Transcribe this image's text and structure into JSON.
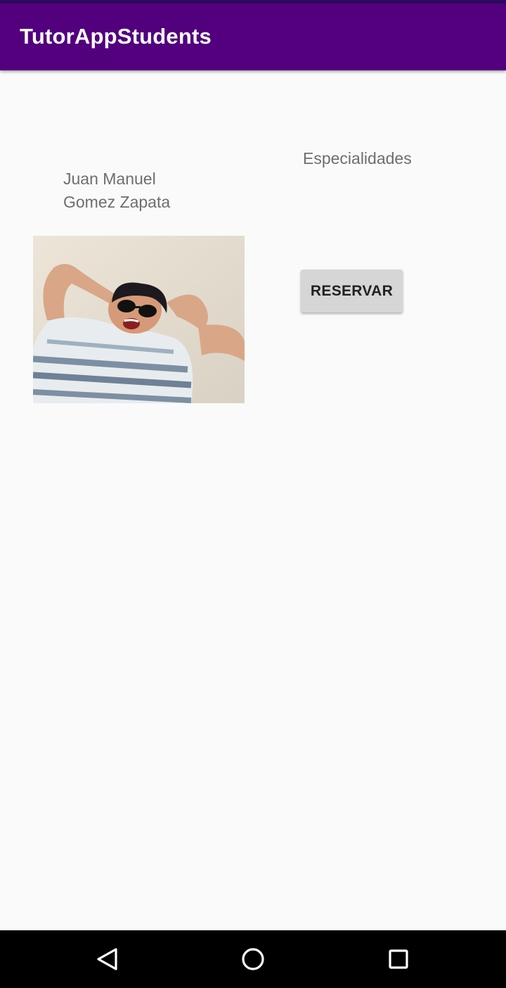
{
  "app_bar": {
    "title": "TutorAppStudents",
    "color": "#52007e"
  },
  "tutor": {
    "first_name": "Juan Manuel",
    "last_name": "Gomez Zapata",
    "photo_icon": "person-photo"
  },
  "specialties_label": "Especialidades",
  "reserve_button": {
    "label": "RESERVAR"
  },
  "nav_bar": {
    "back_icon": "back-triangle-icon",
    "home_icon": "home-circle-icon",
    "recents_icon": "recents-square-icon"
  }
}
